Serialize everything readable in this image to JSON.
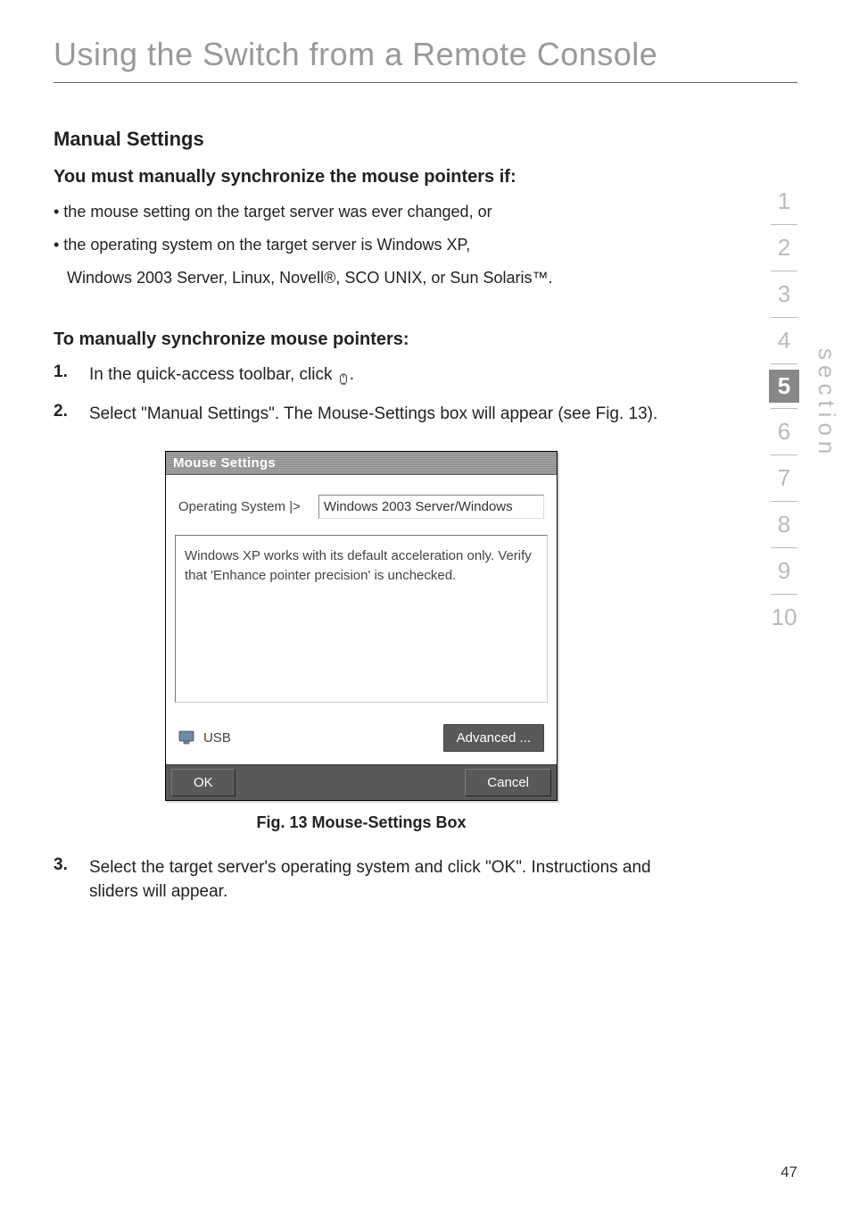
{
  "page_title": "Using the Switch from a Remote Console",
  "heading": "Manual Settings",
  "subheading1": "You must manually synchronize the mouse pointers if:",
  "bullet1": "• the mouse setting on the target server was ever changed, or",
  "bullet2": "• the operating system on the target server is Windows XP,",
  "bullet2b": "Windows 2003 Server, Linux, Novell®, SCO UNIX, or Sun Solaris™.",
  "subheading2": "To manually synchronize mouse pointers:",
  "steps": {
    "s1_num": "1.",
    "s1_text_a": "In the quick-access toolbar, click ",
    "s1_text_b": ".",
    "s2_num": "2.",
    "s2_text": "Select \"Manual Settings\". The Mouse-Settings box will appear (see Fig. 13).",
    "s3_num": "3.",
    "s3_text": "Select the target server's operating system and click \"OK\". Instructions and sliders will appear."
  },
  "dialog": {
    "title": "Mouse Settings",
    "os_label": "Operating System |>",
    "os_value": "Windows 2003 Server/Windows",
    "msg": "Windows XP works with its default acceleration only. Verify that 'Enhance pointer precision' is unchecked.",
    "usb_label": "USB",
    "advanced": "Advanced ...",
    "ok": "OK",
    "cancel": "Cancel"
  },
  "fig_caption": "Fig. 13 Mouse-Settings Box",
  "sidebar": {
    "items": [
      "1",
      "2",
      "3",
      "4",
      "5",
      "6",
      "7",
      "8",
      "9",
      "10"
    ],
    "active_index": 4,
    "section_label": "section"
  },
  "page_number": "47"
}
